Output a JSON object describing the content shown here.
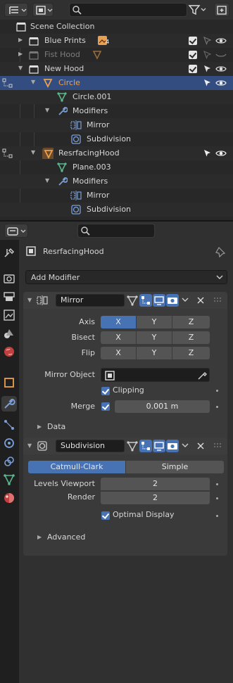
{
  "outliner": {
    "rows": [
      {
        "label": "Scene Collection"
      },
      {
        "label": "Blue Prints",
        "badge": "4"
      },
      {
        "label": "Fist Hood"
      },
      {
        "label": "New Hood"
      },
      {
        "label": "Circle"
      },
      {
        "label": "Circle.001"
      },
      {
        "label": "Modifiers"
      },
      {
        "label": "Mirror"
      },
      {
        "label": "Subdivision"
      },
      {
        "label": "ResrfacingHood"
      },
      {
        "label": "Plane.003"
      },
      {
        "label": "Modifiers"
      },
      {
        "label": "Mirror"
      },
      {
        "label": "Subdivision"
      }
    ]
  },
  "properties": {
    "object_name": "ResrfacingHood",
    "add_modifier_label": "Add Modifier",
    "mirror": {
      "name": "Mirror",
      "axis_label": "Axis",
      "bisect_label": "Bisect",
      "flip_label": "Flip",
      "axes": [
        "X",
        "Y",
        "Z"
      ],
      "mirror_object_label": "Mirror Object",
      "clipping_label": "Clipping",
      "merge_label": "Merge",
      "merge_value": "0.001 m",
      "data_label": "Data"
    },
    "subdivision": {
      "name": "Subdivision",
      "method_catmull": "Catmull-Clark",
      "method_simple": "Simple",
      "levels_viewport_label": "Levels Viewport",
      "levels_viewport_value": "2",
      "render_label": "Render",
      "render_value": "2",
      "optimal_display_label": "Optimal Display",
      "advanced_label": "Advanced"
    }
  },
  "colors": {
    "accent": "#4772b3",
    "selected_row": "#334d80",
    "object_orange": "#e8a050",
    "mesh_green": "#5ab88f",
    "modifier_blue": "#7a9fd8"
  }
}
